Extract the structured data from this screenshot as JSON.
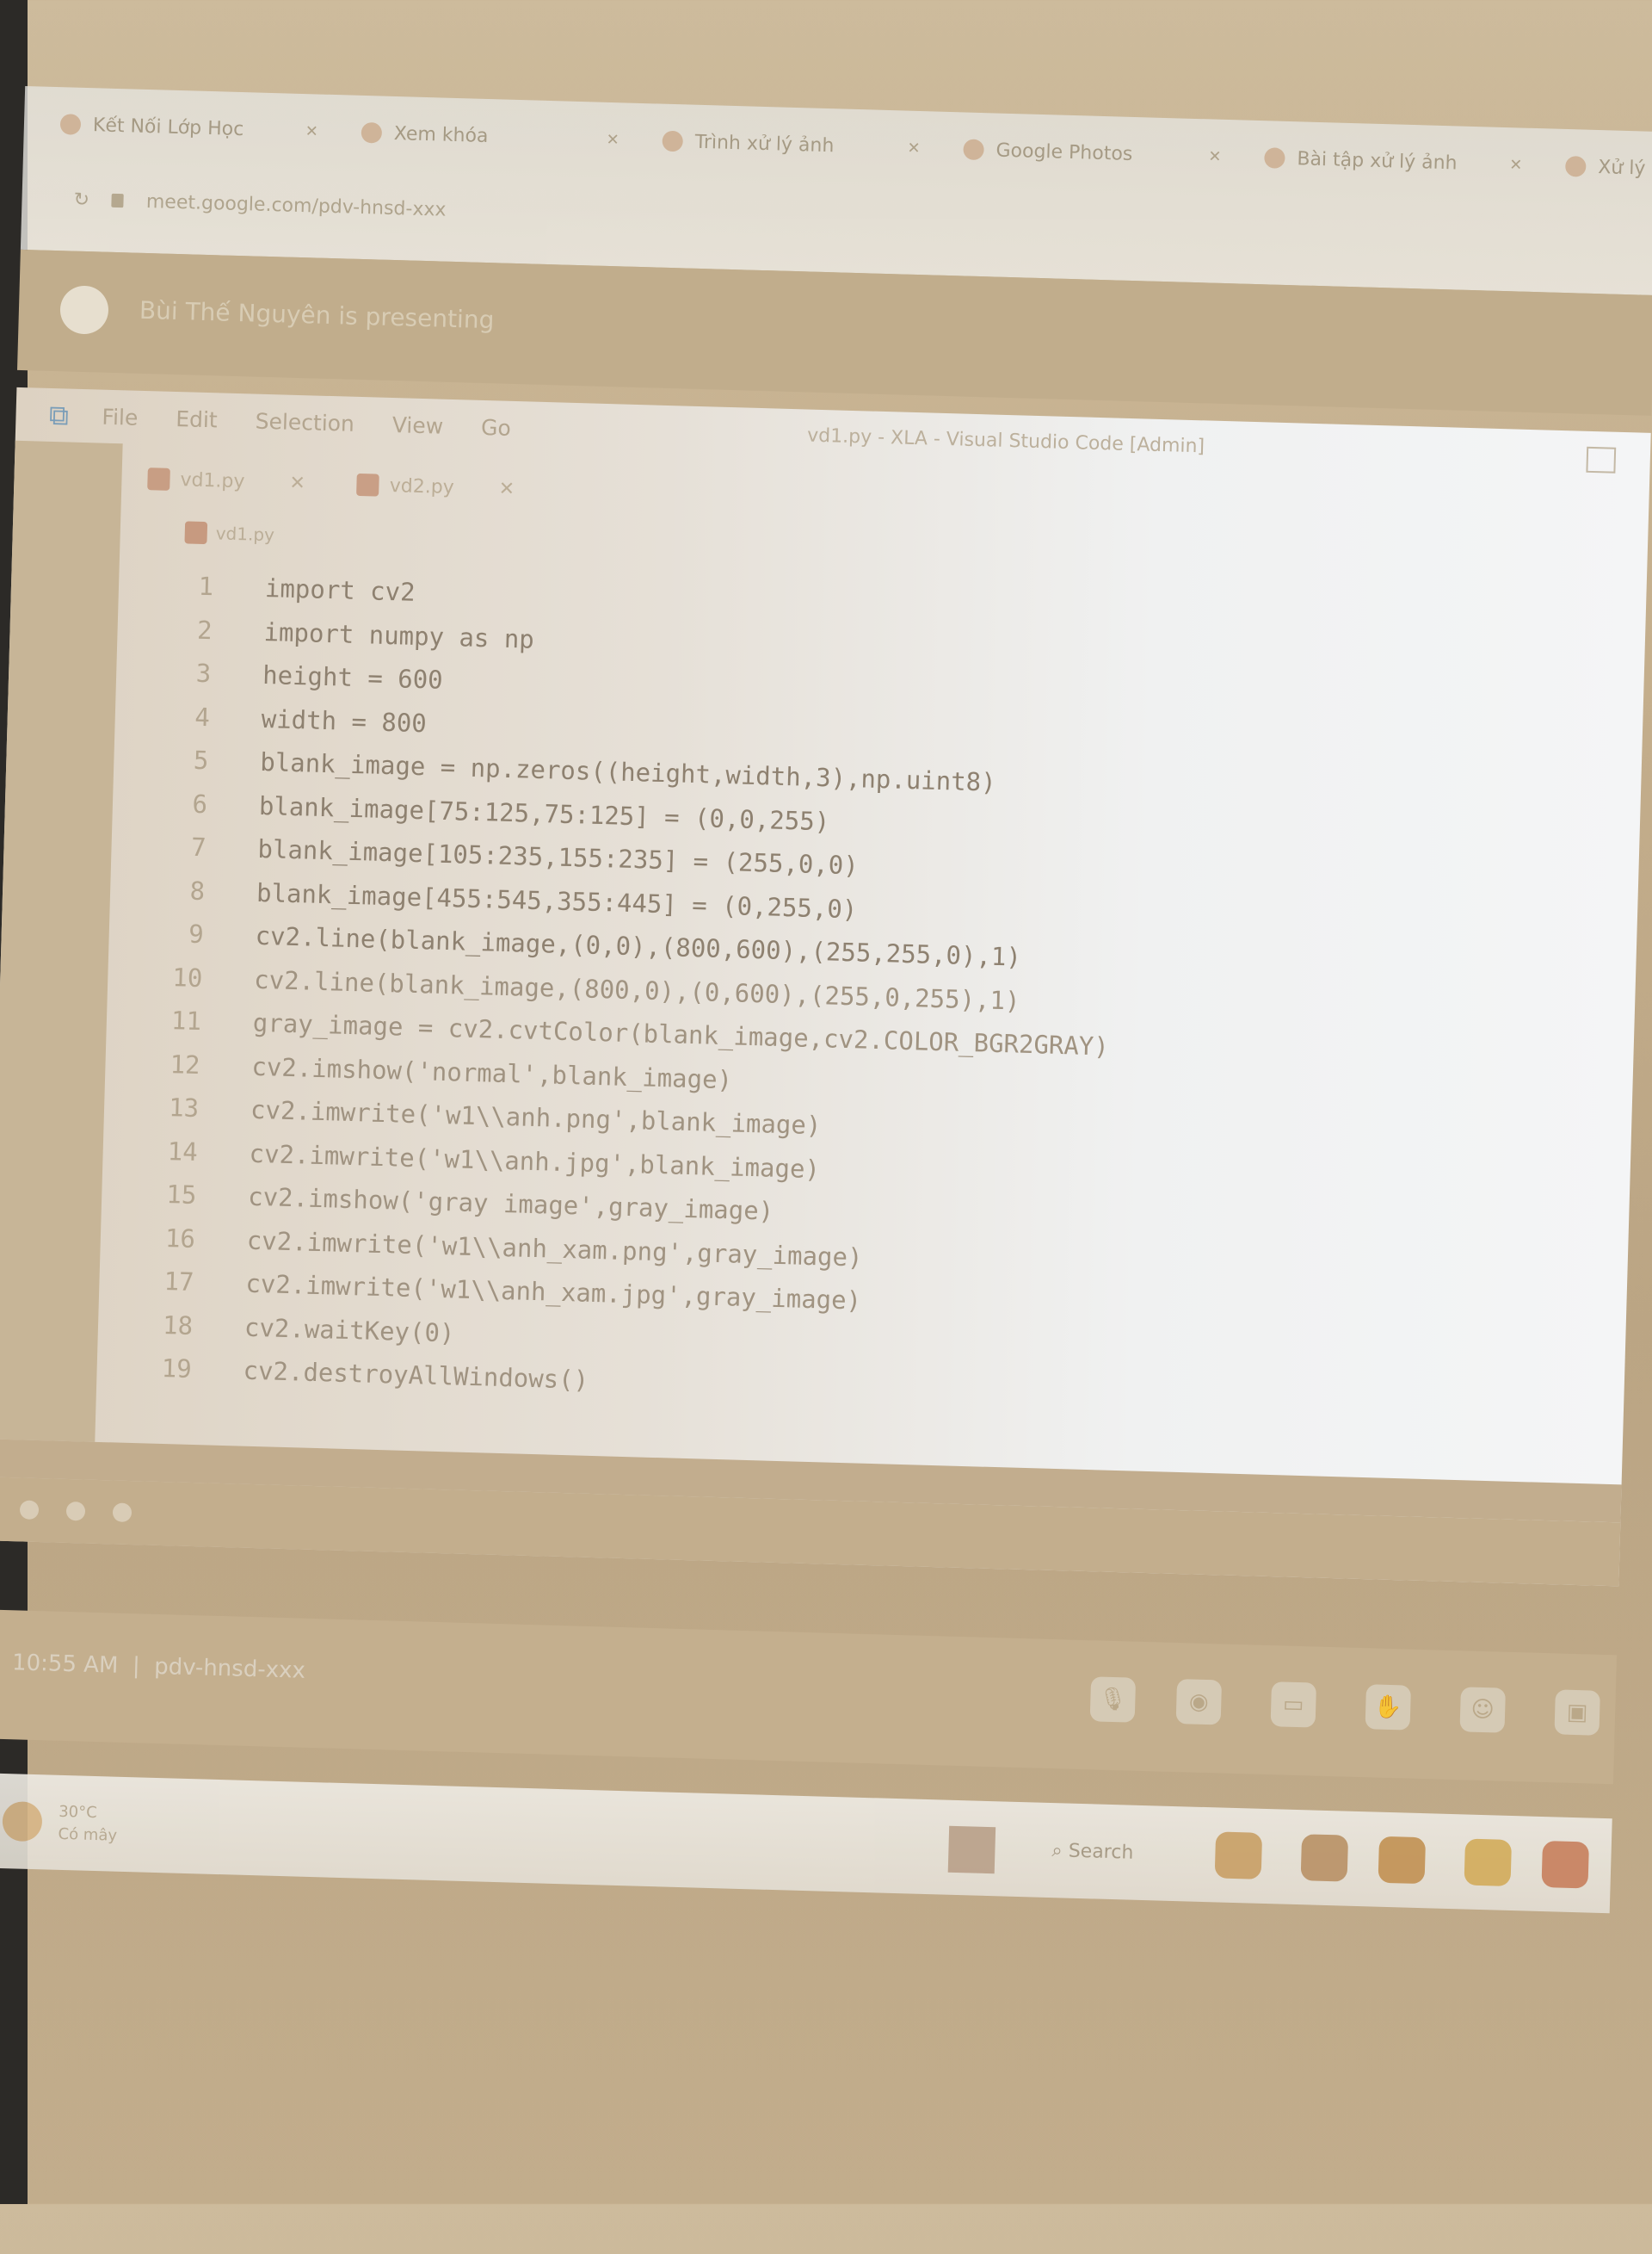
{
  "browser": {
    "tabs": [
      {
        "label": "Kết Nối Lớp Học"
      },
      {
        "label": "Xem khóa"
      },
      {
        "label": "Trình xử lý ảnh"
      },
      {
        "label": "Google Photos"
      },
      {
        "label": "Bài tập xử lý ảnh"
      },
      {
        "label": "Xử lý ảnh"
      }
    ],
    "address": "meet.google.com/pdv-hnsd-xxx"
  },
  "share_banner": {
    "text": "Bùi Thế Nguyên is presenting"
  },
  "vscode": {
    "menu": [
      "File",
      "Edit",
      "Selection",
      "View",
      "Go"
    ],
    "window_title": "vd1.py - XLA - Visual Studio Code [Admin]",
    "tabs": [
      {
        "label": "vd1.py"
      },
      {
        "label": "vd2.py"
      }
    ],
    "breadcrumb": "vd1.py",
    "code_lines": [
      {
        "n": "1",
        "text": "import cv2"
      },
      {
        "n": "2",
        "text": "import numpy as np"
      },
      {
        "n": "3",
        "text": "height = 600"
      },
      {
        "n": "4",
        "text": "width = 800"
      },
      {
        "n": "5",
        "text": "blank_image = np.zeros((height,width,3),np.uint8)"
      },
      {
        "n": "6",
        "text": "blank_image[75:125,75:125] = (0,0,255)"
      },
      {
        "n": "7",
        "text": "blank_image[105:235,155:235] = (255,0,0)"
      },
      {
        "n": "8",
        "text": "blank_image[455:545,355:445] = (0,255,0)"
      },
      {
        "n": "9",
        "text": "cv2.line(blank_image,(0,0),(800,600),(255,255,0),1)"
      },
      {
        "n": "10",
        "text": "cv2.line(blank_image,(800,0),(0,600),(255,0,255),1)"
      },
      {
        "n": "11",
        "text": "gray_image = cv2.cvtColor(blank_image,cv2.COLOR_BGR2GRAY)"
      },
      {
        "n": "12",
        "text": "cv2.imshow('normal',blank_image)"
      },
      {
        "n": "13",
        "text": "cv2.imwrite('w1\\\\anh.png',blank_image)"
      },
      {
        "n": "14",
        "text": "cv2.imwrite('w1\\\\anh.jpg',blank_image)"
      },
      {
        "n": "15",
        "text": "cv2.imshow('gray image',gray_image)"
      },
      {
        "n": "16",
        "text": "cv2.imwrite('w1\\\\anh_xam.png',gray_image)"
      },
      {
        "n": "17",
        "text": "cv2.imwrite('w1\\\\anh_xam.jpg',gray_image)"
      },
      {
        "n": "18",
        "text": "cv2.waitKey(0)"
      },
      {
        "n": "19",
        "text": "cv2.destroyAllWindows()"
      }
    ]
  },
  "meet_bar": {
    "time": "10:55 AM",
    "meeting_code": "pdv-hnsd-xxx"
  },
  "taskbar": {
    "weather": "30°C",
    "weather_sub": "Có mây",
    "search": "Search"
  }
}
